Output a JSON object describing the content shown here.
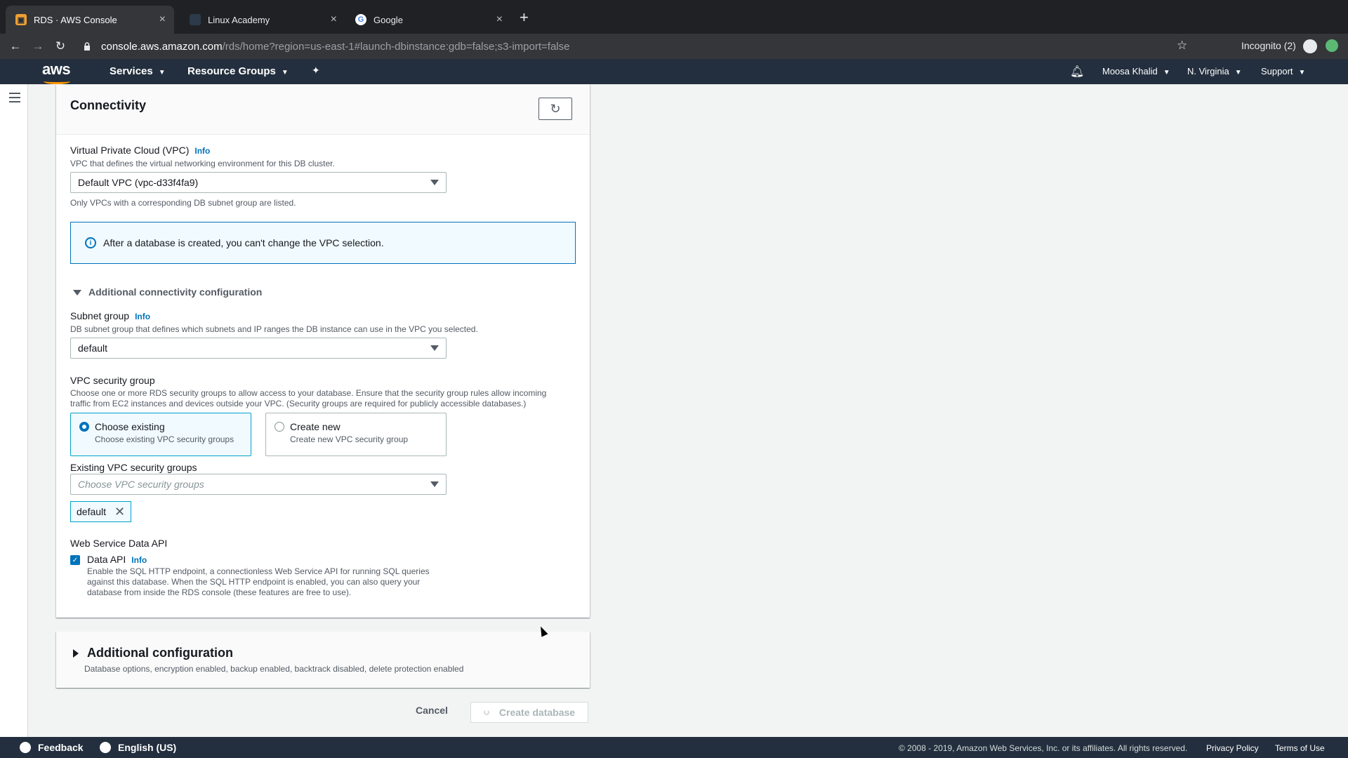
{
  "browser": {
    "tabs": [
      {
        "label": "RDS · AWS Console",
        "active": true
      },
      {
        "label": "Linux Academy",
        "active": false
      },
      {
        "label": "Google",
        "active": false
      }
    ],
    "url_host": "console.aws.amazon.com",
    "url_path": "/rds/home?region=us-east-1#launch-dbinstance:gdb=false;s3-import=false",
    "incognito": "Incognito (2)"
  },
  "awsnav": {
    "services": "Services",
    "resource_groups": "Resource Groups",
    "user": "Moosa Khalid",
    "region": "N. Virginia",
    "support": "Support"
  },
  "connectivity": {
    "title": "Connectivity",
    "vpc_label": "Virtual Private Cloud (VPC)",
    "info": "Info",
    "vpc_desc": "VPC that defines the virtual networking environment for this DB cluster.",
    "vpc_value": "Default VPC (vpc-d33f4fa9)",
    "vpc_note": "Only VPCs with a corresponding DB subnet group are listed.",
    "alert": "After a database is created, you can't change the VPC selection.",
    "additional": "Additional connectivity configuration",
    "subnet_label": "Subnet group",
    "subnet_desc": "DB subnet group that defines which subnets and IP ranges the DB instance can use in the VPC you selected.",
    "subnet_value": "default",
    "sg_label": "VPC security group",
    "sg_desc": "Choose one or more RDS security groups to allow access to your database. Ensure that the security group rules allow incoming traffic from EC2 instances and devices outside your VPC. (Security groups are required for publicly accessible databases.)",
    "choose_existing": "Choose existing",
    "choose_existing_desc": "Choose existing VPC security groups",
    "create_new": "Create new",
    "create_new_desc": "Create new VPC security group",
    "existing_label": "Existing VPC security groups",
    "existing_placeholder": "Choose VPC security groups",
    "token": "default",
    "web_label": "Web Service Data API",
    "data_api": "Data API",
    "data_api_desc": "Enable the SQL HTTP endpoint, a connectionless Web Service API for running SQL queries against this database. When the SQL HTTP endpoint is enabled, you can also query your database from inside the RDS console (these features are free to use)."
  },
  "additional_config": {
    "title": "Additional configuration",
    "desc": "Database options, encryption enabled, backup enabled, backtrack disabled, delete protection enabled"
  },
  "actions": {
    "cancel": "Cancel",
    "create": "Create database"
  },
  "footer": {
    "feedback": "Feedback",
    "language": "English (US)",
    "copyright": "© 2008 - 2019, Amazon Web Services, Inc. or its affiliates. All rights reserved.",
    "privacy": "Privacy Policy",
    "terms": "Terms of Use"
  }
}
